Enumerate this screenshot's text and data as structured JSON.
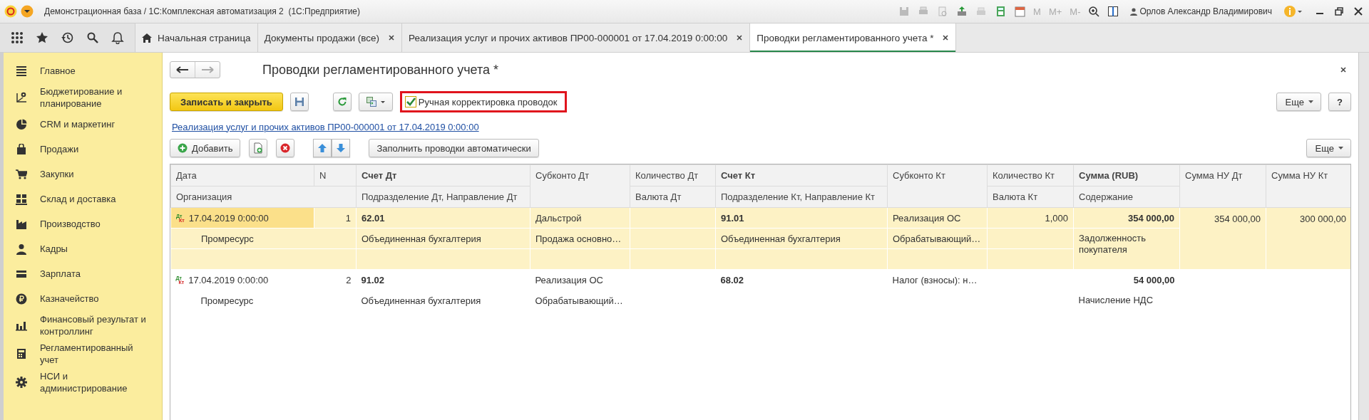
{
  "window": {
    "title": "Демонстрационная база / 1С:Комплексная автоматизация 2  (1С:Предприятие)",
    "memory_buttons": [
      "M",
      "M+",
      "M-"
    ],
    "user": "Орлов Александр Владимирович"
  },
  "tabs": [
    {
      "label": "Начальная страница",
      "kind": "home",
      "selected": false
    },
    {
      "label": "Документы продажи (все)",
      "kind": "doc",
      "selected": false
    },
    {
      "label": "Реализация услуг и прочих активов ПР00-000001 от 17.04.2019 0:00:00",
      "kind": "doc",
      "selected": false
    },
    {
      "label": "Проводки регламентированного учета *",
      "kind": "doc",
      "selected": true
    }
  ],
  "sidebar": {
    "items": [
      {
        "label": "Главное"
      },
      {
        "label": "Бюджетирование и планирование"
      },
      {
        "label": "CRM и маркетинг"
      },
      {
        "label": "Продажи"
      },
      {
        "label": "Закупки"
      },
      {
        "label": "Склад и доставка"
      },
      {
        "label": "Производство"
      },
      {
        "label": "Кадры"
      },
      {
        "label": "Зарплата"
      },
      {
        "label": "Казначейство"
      },
      {
        "label": "Финансовый результат и контроллинг"
      },
      {
        "label": "Регламентированный учет"
      },
      {
        "label": "НСИ и администрирование"
      }
    ]
  },
  "form": {
    "title": "Проводки регламентированного учета *",
    "save_close": "Записать и закрыть",
    "manual_adjust": {
      "label": "Ручная корректировка проводок",
      "checked": true,
      "highlighted": true
    },
    "more": "Еще",
    "help": "?",
    "document_link": "Реализация услуг и прочих активов ПР00-000001 от 17.04.2019 0:00:00",
    "table_toolbar": {
      "add": "Добавить",
      "fill_auto": "Заполнить проводки автоматически",
      "more": "Еще"
    },
    "table": {
      "header_top": [
        {
          "label": "Дата",
          "bold": false
        },
        {
          "label": "N",
          "bold": false
        },
        {
          "label": "Счет Дт",
          "bold": true
        },
        {
          "label": "Субконто Дт",
          "bold": false
        },
        {
          "label": "Количество Дт",
          "bold": false
        },
        {
          "label": "Счет Кт",
          "bold": true
        },
        {
          "label": "Субконто Кт",
          "bold": false
        },
        {
          "label": "Количество Кт",
          "bold": false
        },
        {
          "label": "Сумма (RUB)",
          "bold": true
        },
        {
          "label": "Сумма НУ Дт",
          "bold": false
        },
        {
          "label": "Сумма НУ Кт",
          "bold": false
        }
      ],
      "header_bottom": [
        {
          "label": "Организация",
          "bold": false
        },
        {
          "label": "Подразделение Дт, Направление Дт",
          "bold": false
        },
        {
          "label": "Валюта Дт",
          "bold": false
        },
        {
          "label": "Подразделение Кт, Направление Кт",
          "bold": false
        },
        {
          "label": "Валюта Кт",
          "bold": false
        },
        {
          "label": "Содержание",
          "bold": false
        }
      ],
      "rows": [
        {
          "selected": true,
          "mark_dt": "Дт",
          "mark_kt": "Кт",
          "date": "17.04.2019 0:00:00",
          "n": "1",
          "account_dt": "62.01",
          "subconto_dt_1": "Дальстрой",
          "account_kt": "91.01",
          "subconto_kt_1": "Реализация ОС",
          "qty_kt": "1,000",
          "amount": "354 000,00",
          "amount_nu_dt": "354 000,00",
          "amount_nu_kt": "300 000,00",
          "organization": "Промресурс",
          "department_dt": "Объединенная бухгалтерия",
          "subconto_dt_2": "Продажа основно…",
          "department_kt": "Объединенная бухгалтерия",
          "subconto_kt_2": "Обрабатывающий…",
          "content": "Задолженность покупателя"
        },
        {
          "selected": false,
          "mark_dt": "Дт",
          "mark_kt": "Кт",
          "date": "17.04.2019 0:00:00",
          "n": "2",
          "account_dt": "91.02",
          "subconto_dt_1": "Реализация ОС",
          "account_kt": "68.02",
          "subconto_kt_1": "Налог (взносы): н…",
          "amount": "54 000,00",
          "organization": "Промресурс",
          "department_dt": "Объединенная бухгалтерия",
          "subconto_dt_2": "Обрабатывающий…",
          "content": "Начисление НДС"
        }
      ]
    }
  }
}
